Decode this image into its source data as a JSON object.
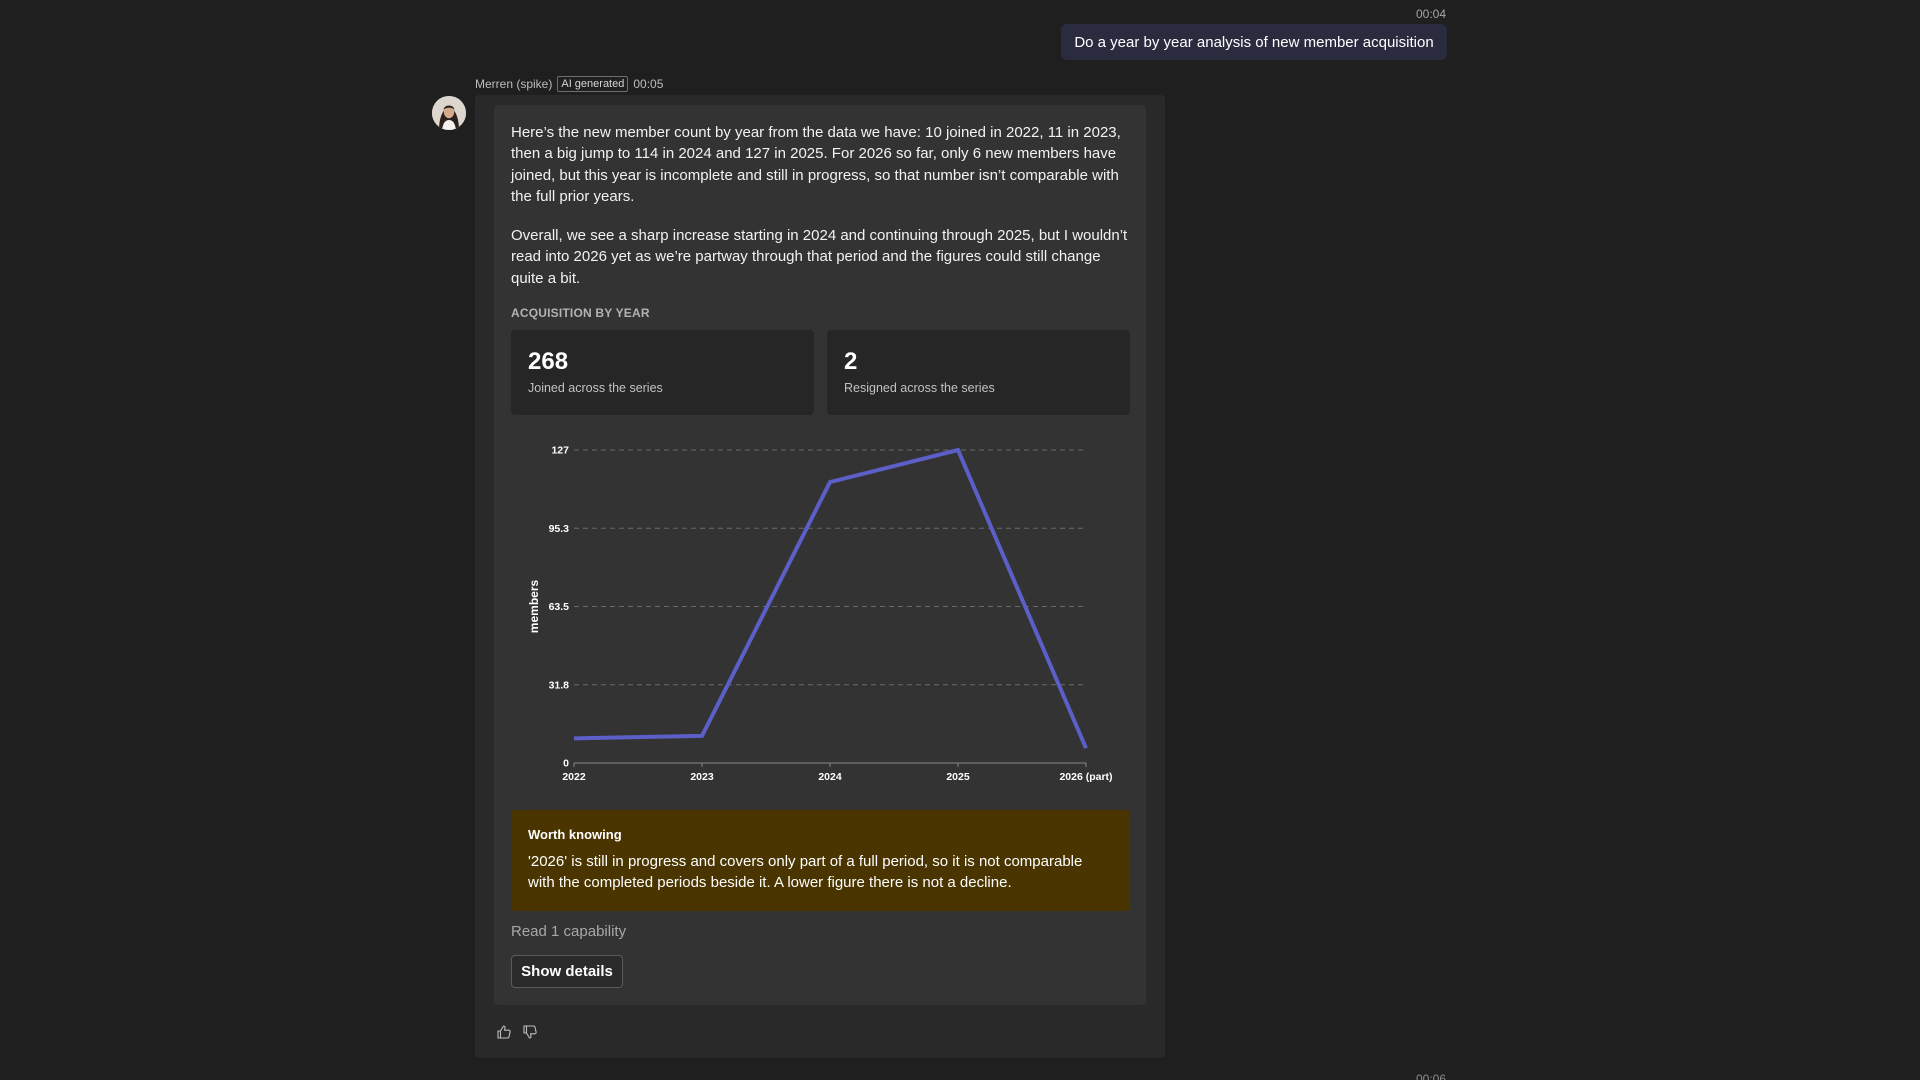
{
  "user_message": {
    "time": "00:04",
    "text": "Do a year by year analysis of new member acquisition"
  },
  "bot_message": {
    "author": "Merren (spike)",
    "badge": "AI generated",
    "time": "00:05",
    "paragraphs": [
      "Here’s the new member count by year from the data we have: 10 joined in 2022, 11 in 2023, then a big jump to 114 in 2024 and 127 in 2025. For 2026 so far, only 6 new members have joined, but this year is incomplete and still in progress, so that number isn’t comparable with the full prior years.",
      "Overall, we see a sharp increase starting in 2024 and continuing through 2025, but I wouldn’t read into 2026 yet as we’re partway through that period and the figures could still change quite a bit."
    ],
    "section_label": "ACQUISITION BY YEAR",
    "stats": [
      {
        "value": "268",
        "caption": "Joined across the series"
      },
      {
        "value": "2",
        "caption": "Resigned across the series"
      }
    ],
    "notice": {
      "title": "Worth knowing",
      "text": "'2026' is still in progress and covers only part of a full period, so it is not comparable with the completed periods beside it. A lower figure there is not a decline."
    },
    "capability_text": "Read 1 capability",
    "details_button": "Show details",
    "reactions": [
      {
        "icon": "thumbs-up-icon"
      },
      {
        "icon": "thumbs-down-icon"
      }
    ]
  },
  "next_time": "00:06",
  "colors": {
    "background": "#1f1f1f",
    "card": "#333333",
    "user_bubble": "#2b2b40",
    "series": "#5b5fc7",
    "notice": "#4a3500"
  },
  "chart_data": {
    "type": "line",
    "categories": [
      "2022",
      "2023",
      "2024",
      "2025",
      "2026 (part)"
    ],
    "values": [
      10,
      11,
      114,
      127,
      6
    ],
    "ylabel": "members",
    "yticks": [
      "0",
      "31.8",
      "63.5",
      "95.3",
      "127"
    ],
    "ylim": [
      0,
      127
    ],
    "grid": true,
    "legend": "none"
  }
}
